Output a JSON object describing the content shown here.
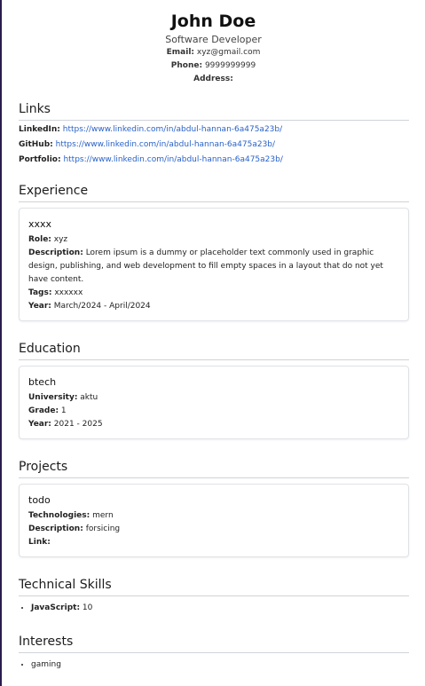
{
  "header": {
    "name": "John Doe",
    "title": "Software Developer",
    "email_label": "Email:",
    "email": "xyz@gmail.com",
    "phone_label": "Phone:",
    "phone": "9999999999",
    "address_label": "Address:",
    "address": ""
  },
  "links": {
    "heading": "Links",
    "items": [
      {
        "label": "LinkedIn:",
        "url": "https://www.linkedin.com/in/abdul-hannan-6a475a23b/"
      },
      {
        "label": "GitHub:",
        "url": "https://www.linkedin.com/in/abdul-hannan-6a475a23b/"
      },
      {
        "label": "Portfolio:",
        "url": "https://www.linkedin.com/in/abdul-hannan-6a475a23b/"
      }
    ]
  },
  "experience": {
    "heading": "Experience",
    "items": [
      {
        "title": "xxxx",
        "role_label": "Role:",
        "role": "xyz",
        "desc_label": "Description:",
        "desc": "Lorem ipsum is a dummy or placeholder text commonly used in graphic design, publishing, and web development to fill empty spaces in a layout that do not yet have content.",
        "tags_label": "Tags:",
        "tags": "xxxxxx",
        "year_label": "Year:",
        "year": "March/2024 - April/2024"
      }
    ]
  },
  "education": {
    "heading": "Education",
    "items": [
      {
        "title": "btech",
        "univ_label": "University:",
        "univ": "aktu",
        "grade_label": "Grade:",
        "grade": "1",
        "year_label": "Year:",
        "year": "2021 - 2025"
      }
    ]
  },
  "projects": {
    "heading": "Projects",
    "items": [
      {
        "title": "todo",
        "tech_label": "Technologies:",
        "tech": "mern",
        "desc_label": "Description:",
        "desc": "forsicing",
        "link_label": "Link:",
        "link": ""
      }
    ]
  },
  "skills": {
    "heading": "Technical Skills",
    "items": [
      {
        "name": "JavaScript:",
        "value": "10"
      }
    ]
  },
  "interests": {
    "heading": "Interests",
    "items": [
      "gaming"
    ]
  },
  "colors": {
    "link": "#2962c9",
    "divider": "#cfd3d8",
    "left_border": "#2b1c4e"
  }
}
